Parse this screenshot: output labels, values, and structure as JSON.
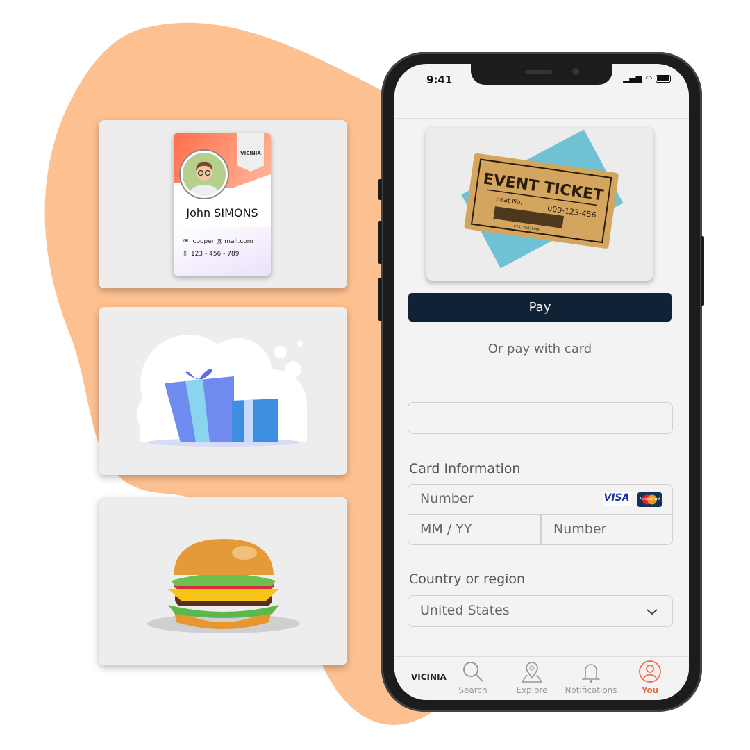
{
  "brand": {
    "logo_text": "VICINIA",
    "accent": "#f06a45",
    "blob": "#fdc090"
  },
  "cards": {
    "id_card": {
      "name": "John SIMONS",
      "email": "cooper @ mail.com",
      "phone": "123 - 456 - 789",
      "logo_text": "VICINIA"
    },
    "gift": {
      "icon": "gift-box"
    },
    "food": {
      "icon": "burger"
    }
  },
  "phone": {
    "status": {
      "time": "9:41",
      "icons": [
        "signal-icon",
        "wifi-icon",
        "battery-icon"
      ]
    },
    "ticket": {
      "title": "EVENT TICKET",
      "seat_label": "Seat No.",
      "seat_number": "000-123-456",
      "barcode_number": "#74725839000"
    },
    "pay_button": "Pay",
    "divider_text": "Or pay with card",
    "email_input": {
      "value": ""
    },
    "card_info": {
      "label": "Card Information",
      "number_placeholder": "Number",
      "expiry_placeholder": "MM / YY",
      "cvc_placeholder": "Number",
      "brands": [
        "VISA",
        "MasterCard"
      ]
    },
    "country": {
      "label": "Country or region",
      "value": "United States"
    },
    "nav": [
      {
        "label": "Search",
        "icon": "search-icon"
      },
      {
        "label": "Explore",
        "icon": "map-pin-icon"
      },
      {
        "label": "Notifications",
        "icon": "bell-icon"
      },
      {
        "label": "You",
        "icon": "user-icon",
        "active": true
      }
    ]
  }
}
